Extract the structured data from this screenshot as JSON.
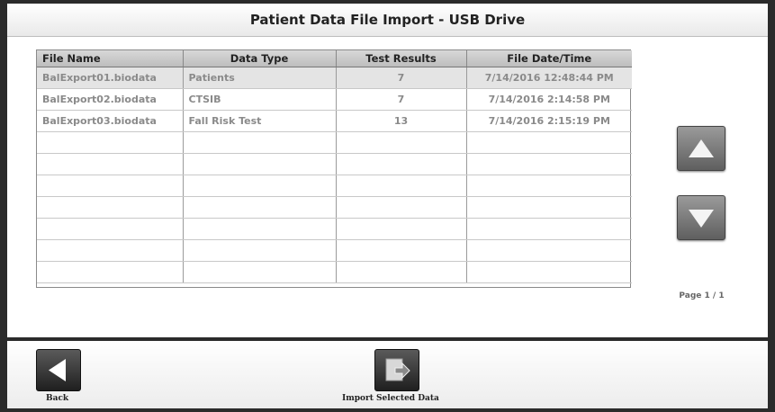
{
  "window": {
    "title": "Patient Data File Import - USB Drive"
  },
  "table": {
    "columns": [
      "File Name",
      "Data Type",
      "Test Results",
      "File Date/Time"
    ],
    "rows": [
      {
        "file_name": "BalExport01.biodata",
        "data_type": "Patients",
        "test_results": "7",
        "file_date": "7/14/2016 12:48:44 PM",
        "selected": true
      },
      {
        "file_name": "BalExport02.biodata",
        "data_type": "CTSIB",
        "test_results": "7",
        "file_date": "7/14/2016 2:14:58 PM",
        "selected": false
      },
      {
        "file_name": "BalExport03.biodata",
        "data_type": "Fall Risk Test",
        "test_results": "13",
        "file_date": "7/14/2016 2:15:19 PM",
        "selected": false
      }
    ]
  },
  "scroll": {
    "up_icon": "triangle-up-icon",
    "down_icon": "triangle-down-icon"
  },
  "pagination": {
    "label": "Page 1 / 1"
  },
  "footer": {
    "back_label": "Back",
    "back_icon": "triangle-left-icon",
    "import_label": "Import Selected Data",
    "import_icon": "import-arrow-icon"
  }
}
